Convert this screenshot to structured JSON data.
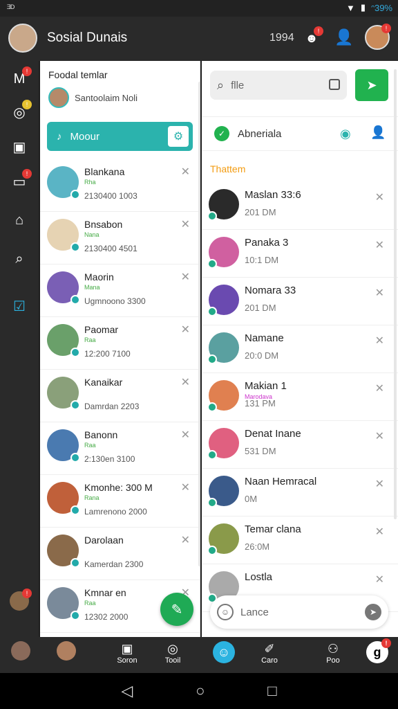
{
  "statusbar": {
    "left": "ᴲᴰ",
    "battery": "ᵔ39%"
  },
  "appbar": {
    "title": "Sosial Dunais",
    "count": "1994",
    "badge": "!"
  },
  "rail": {
    "items": [
      {
        "icon": "mail-icon",
        "glyph": "M",
        "badge": "!"
      },
      {
        "icon": "camera-icon",
        "glyph": "◎",
        "badge": "!"
      },
      {
        "icon": "square-icon",
        "glyph": "▣",
        "badge": ""
      },
      {
        "icon": "tv-icon",
        "glyph": "▭",
        "badge": "!"
      },
      {
        "icon": "home-icon",
        "glyph": "⌂",
        "badge": ""
      },
      {
        "icon": "search-icon",
        "glyph": "⌕",
        "badge": ""
      },
      {
        "icon": "check-icon",
        "glyph": "☑",
        "badge": ""
      }
    ]
  },
  "left_panel": {
    "title": "Foodal temlar",
    "subtitle": "Santoolaim Noli",
    "search_label": "Moour",
    "contacts": [
      {
        "name": "Blankana",
        "tag": "Rha",
        "meta": "2130400 1003",
        "color": "#5ab4c5"
      },
      {
        "name": "Bnsabon",
        "tag": "Nana",
        "meta": "2130400 4501",
        "color": "#e6d3b3"
      },
      {
        "name": "Maorin",
        "tag": "Mana",
        "meta": "Ugmnoono 3300",
        "color": "#7a5fb5"
      },
      {
        "name": "Paomar",
        "tag": "Raa",
        "meta": "12:200 7100",
        "color": "#6aa06a"
      },
      {
        "name": "Kanaikar",
        "tag": "",
        "meta": "Damrdan 2203",
        "color": "#8aa07a"
      },
      {
        "name": "Banonn",
        "tag": "Raa",
        "meta": "2:130en 3100",
        "color": "#4a7ab0"
      },
      {
        "name": "Kmonhe: 300 M",
        "tag": "Rana",
        "meta": "Lamrenono 2000",
        "color": "#c0603a"
      },
      {
        "name": "Darolaan",
        "tag": "",
        "meta": "Kamerdan 2300",
        "color": "#8a6a4a"
      },
      {
        "name": "Kmnar en",
        "tag": "Raa",
        "meta": "12302 2000",
        "color": "#7a8a9a"
      }
    ]
  },
  "right_panel": {
    "search_placeholder": "flle",
    "tab_label": "Abneriala",
    "section_label": "Thattem",
    "compose_placeholder": "Lance",
    "chats": [
      {
        "name": "Maslan 33:6",
        "tag": "",
        "time": "201 DM",
        "color": "#2a2a2a"
      },
      {
        "name": "Panaka 3",
        "tag": "",
        "time": "10:1 DM",
        "color": "#d060a0"
      },
      {
        "name": "Nomara 33",
        "tag": "",
        "time": "201 DM",
        "color": "#6a4ab0"
      },
      {
        "name": "Namane",
        "tag": "",
        "time": "20:0 DM",
        "color": "#5aa0a0"
      },
      {
        "name": "Makian 1",
        "tag": "Marodava",
        "time": "131 PM",
        "color": "#e08050"
      },
      {
        "name": "Denat Inane",
        "tag": "",
        "time": "531 DM",
        "color": "#e06080"
      },
      {
        "name": "Naan Hemracal",
        "tag": "",
        "time": "0M",
        "color": "#3a5a8a"
      },
      {
        "name": "Temar clana",
        "tag": "",
        "time": "26:0M",
        "color": "#8a9a4a"
      },
      {
        "name": "Lostla",
        "tag": "",
        "time": "",
        "color": "#aaaaaa"
      }
    ]
  },
  "bottom_nav": [
    {
      "icon": "avatar-icon",
      "label": ""
    },
    {
      "icon": "avatar-icon",
      "label": ""
    },
    {
      "icon": "square-icon",
      "label": "Soron"
    },
    {
      "icon": "camera-icon",
      "label": "Tooil"
    },
    {
      "icon": "people-icon",
      "label": ""
    },
    {
      "icon": "edit-icon",
      "label": "Caro"
    },
    {
      "icon": "group-icon",
      "label": "Poo"
    },
    {
      "icon": "profile-icon",
      "label": ""
    }
  ],
  "colors": {
    "accent": "#2bb3ad",
    "green": "#21b24f",
    "orange": "#f39c12"
  }
}
